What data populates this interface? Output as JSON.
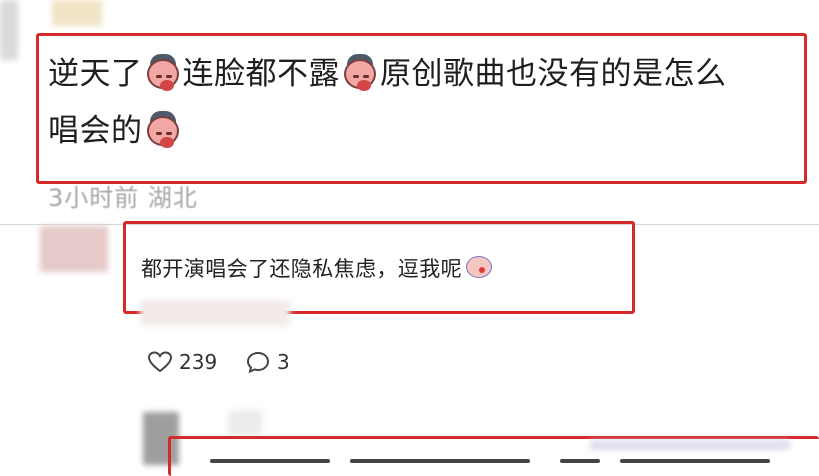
{
  "comment1": {
    "segments": [
      "逆天了",
      "连脸都不露",
      "原创歌曲也没有的是怎么",
      "唱会的"
    ],
    "meta": "3小时前 湖北"
  },
  "reply": {
    "text": "都开演唱会了还隐私焦虑，逗我呢"
  },
  "actions": {
    "likes": "239",
    "comments": "3"
  },
  "colors": {
    "highlight_box": "#d62a2a",
    "meta_text": "#a6a6a6"
  },
  "icons": [
    "heart-icon",
    "comment-bubble-icon",
    "crying-face-emoji",
    "clown-face-emoji"
  ]
}
